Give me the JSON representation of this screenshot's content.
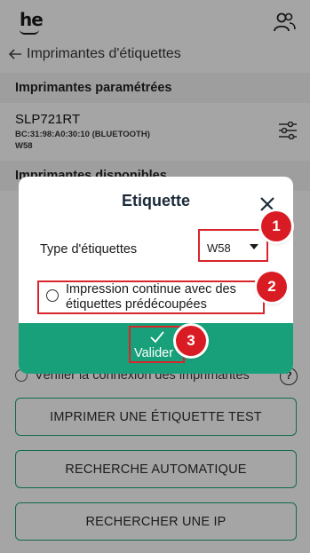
{
  "app": {
    "logo_text": "he"
  },
  "nav": {
    "back_title": "Imprimantes d'étiquettes"
  },
  "sections": {
    "configured": "Imprimantes paramétrées",
    "available": "Imprimantes disponibles"
  },
  "printer": {
    "name": "SLP721RT",
    "address": "BC:31:98:A0:30:10 (BLUETOOTH)",
    "model": "W58"
  },
  "verify": {
    "label": "Vérifier la connexion des imprimantes",
    "help": "?"
  },
  "buttons": {
    "test": "IMPRIMER UNE ÉTIQUETTE TEST",
    "auto_search": "RECHERCHE AUTOMATIQUE",
    "ip_search": "RECHERCHER UNE IP"
  },
  "modal": {
    "title": "Etiquette",
    "type_label": "Type d'étiquettes",
    "type_value": "W58",
    "continuous_label": "Impression continue avec des étiquettes prédécoupées",
    "validate_label": "Valider"
  },
  "badges": [
    "1",
    "2",
    "3"
  ],
  "colors": {
    "accent": "#17a07a",
    "highlight": "#d8262a",
    "badge": "#d91c23"
  }
}
